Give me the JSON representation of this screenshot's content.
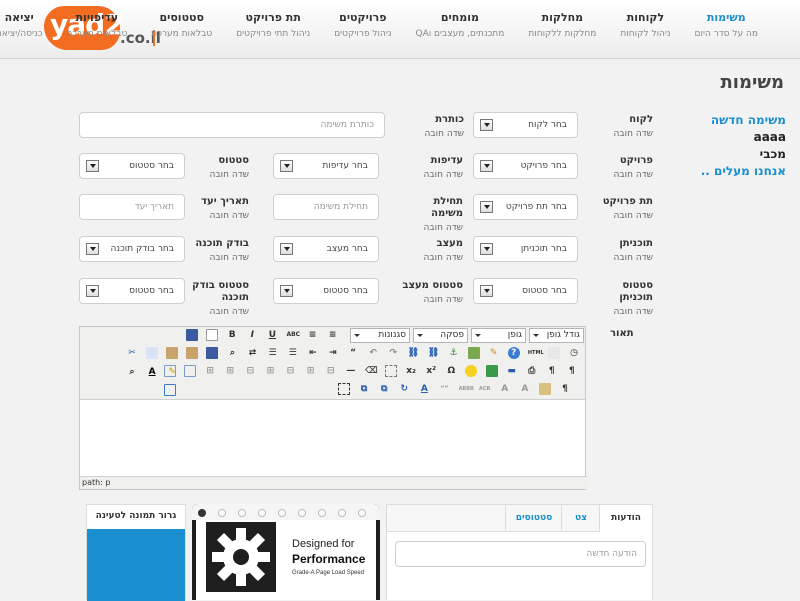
{
  "logo": {
    "name": "yad2",
    "tld": ".co.il"
  },
  "nav": [
    {
      "label": "משימות",
      "sub": "מה על סדר היום",
      "active": true
    },
    {
      "label": "לקוחות",
      "sub": "ניהול לקוחות"
    },
    {
      "label": "מחלקות",
      "sub": "מחלקות ללקוחות"
    },
    {
      "label": "מומחים",
      "sub": "מתכנתים, מעצבים וQA"
    },
    {
      "label": "פרויקטים",
      "sub": "ניהול פרויקטים"
    },
    {
      "label": "תת פרויקט",
      "sub": "ניהול תתי פרויקטים"
    },
    {
      "label": "סטטוסים",
      "sub": "טבלאות מערכת"
    },
    {
      "label": "עדיפויות",
      "sub": "טבלאות מערכת"
    },
    {
      "label": "יציאה",
      "sub": "כניסה/יציאה"
    }
  ],
  "page": {
    "title": "משימות"
  },
  "side_links": [
    {
      "label": "משימה חדשה",
      "style": "blue"
    },
    {
      "label": "aaaa",
      "style": "dark"
    },
    {
      "label": "מכבי",
      "style": "dark"
    },
    {
      "label": "אנחנו מעלים ..",
      "style": "blue"
    }
  ],
  "form": {
    "required_text": "שדה חובה",
    "fields": {
      "client": {
        "label": "לקוח",
        "value": "בחר לקוח"
      },
      "title": {
        "label": "כותרת",
        "placeholder": "כותרת משימה"
      },
      "project": {
        "label": "פרויקט",
        "value": "בחר פרויקט"
      },
      "priority": {
        "label": "עדיפות",
        "value": "בחר עדיפות"
      },
      "status": {
        "label": "סטטוס",
        "value": "בחר סטטוס"
      },
      "subproject": {
        "label": "תת פרויקט",
        "value": "בחר תת פרויקט"
      },
      "start": {
        "label": "תחילת משימה",
        "placeholder": "תחילת משימה"
      },
      "due": {
        "label": "תאריך יעד",
        "placeholder": "תאריך יעד"
      },
      "programmer": {
        "label": "תוכניתן",
        "value": "בחר תוכניתן"
      },
      "designer": {
        "label": "מעצב",
        "value": "בחר מעצב"
      },
      "tester": {
        "label": "בודק תוכנה",
        "value": "בחר בודק תוכנה"
      },
      "programmer_status": {
        "label": "סטטוס תוכניתן",
        "value": "בחר סטטוס"
      },
      "designer_status": {
        "label": "סטטוס מעצב",
        "value": "בחר סטטוס"
      },
      "tester_status": {
        "label": "סטטוס בודק תוכנה",
        "value": "בחר סטטוס"
      }
    },
    "description_label": "תאור"
  },
  "editor": {
    "font_size": "גודל גופן",
    "font": "גופן",
    "format": "פסקה",
    "styles": "סגנונות",
    "path": "path: p"
  },
  "tabs": {
    "items": [
      "הודעות",
      "צט",
      "סטטוסים"
    ],
    "message_placeholder": "הודעה חדשה"
  },
  "promo": {
    "line1": "Designed for",
    "line2": "Performance",
    "line3": "Grade-A Page Load Speed"
  },
  "upload": {
    "title": "גרור תמונה לטעינה"
  }
}
